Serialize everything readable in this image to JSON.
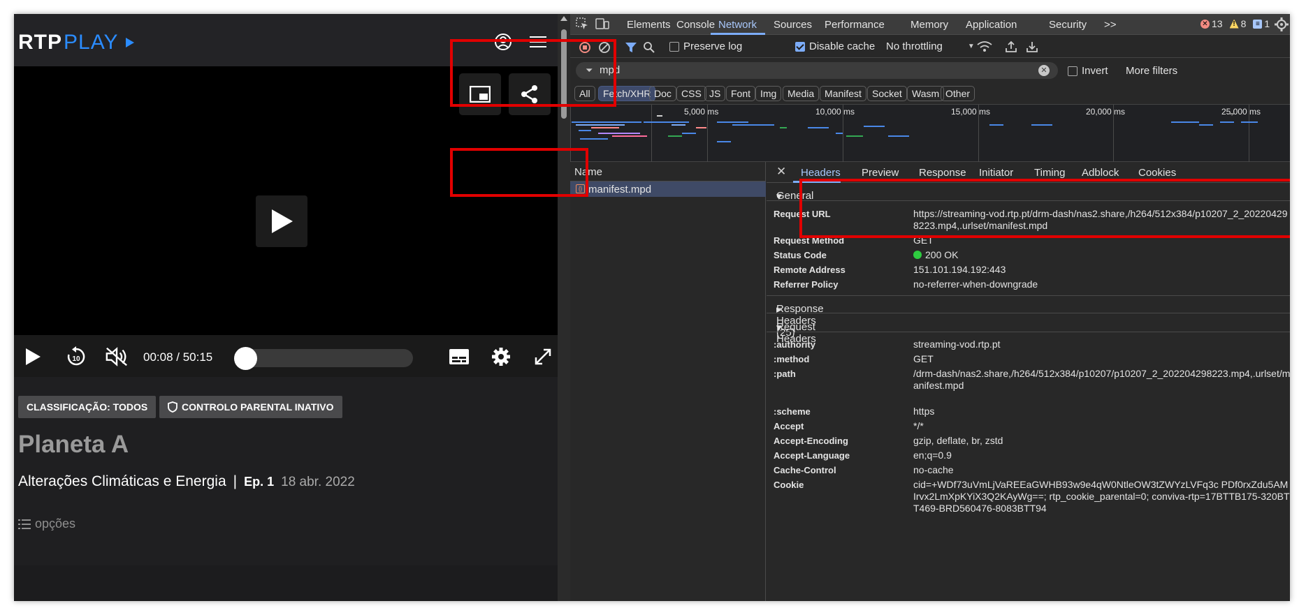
{
  "player": {
    "logo_rtp": "RTP",
    "logo_play": "PLAY",
    "time": "00:08 / 50:15",
    "seek_fraction": 0.003,
    "badge_classificacao": "CLASSIFICAÇÃO: TODOS",
    "badge_parental": "CONTROLO PARENTAL INATIVO",
    "show_title": "Planeta A",
    "episode_title": "Alterações Climáticas e Energia",
    "separator": "|",
    "episode_number": "Ep. 1",
    "episode_date": "18 abr. 2022",
    "options_label": "opções"
  },
  "devtools": {
    "tabs": [
      "Elements",
      "Console",
      "Network",
      "Sources",
      "Performance",
      "Memory",
      "Application",
      "Security"
    ],
    "more_tabs": ">>",
    "errors": "13",
    "warnings": "8",
    "infos": "1",
    "toolbar": {
      "preserve_log": "Preserve log",
      "disable_cache": "Disable cache",
      "throttling": "No throttling"
    },
    "filter": {
      "value": "mpd",
      "invert": "Invert",
      "more_filters": "More filters"
    },
    "types": [
      "All",
      "Fetch/XHR",
      "Doc",
      "CSS",
      "JS",
      "Font",
      "Img",
      "Media",
      "Manifest",
      "Socket",
      "Wasm",
      "Other"
    ],
    "timeline_labels": [
      "5,000 ms",
      "10,000 ms",
      "15,000 ms",
      "20,000 ms",
      "25,000 ms"
    ],
    "name_header": "Name",
    "request_name": "manifest.mpd",
    "detail_tabs": [
      "Headers",
      "Preview",
      "Response",
      "Initiator",
      "Timing",
      "Adblock",
      "Cookies"
    ],
    "close_symbol": "✕",
    "general": {
      "title": "General",
      "rows": [
        {
          "key": "Request URL",
          "value": "https://streaming-vod.rtp.pt/drm-dash/nas2.share,/h264/512x384/p10207_2_202204298223.mp4,.urlset/manifest.mpd"
        },
        {
          "key": "Request Method",
          "value": "GET"
        },
        {
          "key": "Status Code",
          "value": "200 OK"
        },
        {
          "key": "Remote Address",
          "value": "151.101.194.192:443"
        },
        {
          "key": "Referrer Policy",
          "value": "no-referrer-when-downgrade"
        }
      ]
    },
    "response_headers": "Response Headers (25)",
    "request_headers": {
      "title": "Request Headers",
      "rows": [
        {
          "key": ":authority",
          "value": "streaming-vod.rtp.pt"
        },
        {
          "key": ":method",
          "value": "GET"
        },
        {
          "key": ":path",
          "value": "/drm-dash/nas2.share,/h264/512x384/p10207/p10207_2_202204298223.mp4,.urlset/manifest.mpd"
        },
        {
          "key": ":scheme",
          "value": "https"
        },
        {
          "key": "Accept",
          "value": "*/*"
        },
        {
          "key": "Accept-Encoding",
          "value": "gzip, deflate, br, zstd"
        },
        {
          "key": "Accept-Language",
          "value": "en;q=0.9"
        },
        {
          "key": "Cache-Control",
          "value": "no-cache"
        },
        {
          "key": "Cookie",
          "value": "cid=+WDf73uVmLjVaREEaGWHB93w9e4qW0NtleOW3tZWYzLVFq3c PDf0rxZdu5AMIrvx2LmXpKYiX3Q2KAyWg==; rtp_cookie_parental=0; conviva-rtp=17BTTB175-320BTT469-BRD560476-8083BTT94"
        }
      ]
    }
  },
  "colors": {
    "accent": "#7cacf8",
    "rtp_blue": "#2b8cff",
    "annotation_red": "#e10000"
  }
}
